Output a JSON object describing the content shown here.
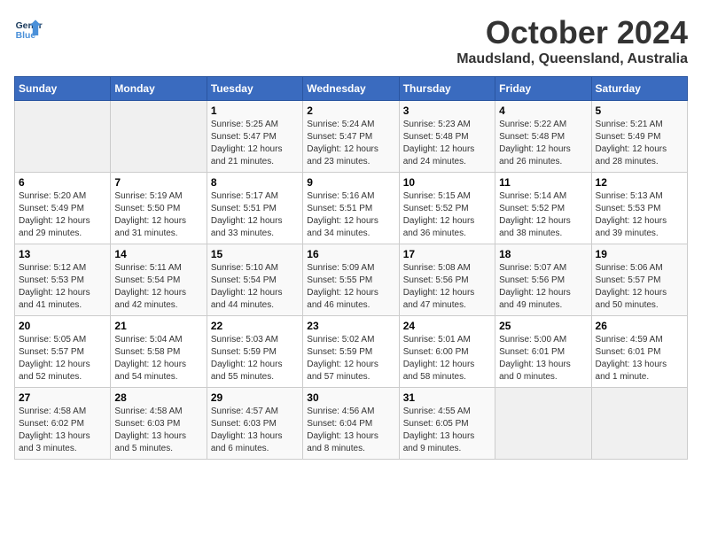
{
  "logo": {
    "line1": "General",
    "line2": "Blue"
  },
  "title": "October 2024",
  "location": "Maudsland, Queensland, Australia",
  "days_of_week": [
    "Sunday",
    "Monday",
    "Tuesday",
    "Wednesday",
    "Thursday",
    "Friday",
    "Saturday"
  ],
  "weeks": [
    [
      {
        "day": "",
        "sunrise": "",
        "sunset": "",
        "daylight": ""
      },
      {
        "day": "",
        "sunrise": "",
        "sunset": "",
        "daylight": ""
      },
      {
        "day": "1",
        "sunrise": "Sunrise: 5:25 AM",
        "sunset": "Sunset: 5:47 PM",
        "daylight": "Daylight: 12 hours and 21 minutes."
      },
      {
        "day": "2",
        "sunrise": "Sunrise: 5:24 AM",
        "sunset": "Sunset: 5:47 PM",
        "daylight": "Daylight: 12 hours and 23 minutes."
      },
      {
        "day": "3",
        "sunrise": "Sunrise: 5:23 AM",
        "sunset": "Sunset: 5:48 PM",
        "daylight": "Daylight: 12 hours and 24 minutes."
      },
      {
        "day": "4",
        "sunrise": "Sunrise: 5:22 AM",
        "sunset": "Sunset: 5:48 PM",
        "daylight": "Daylight: 12 hours and 26 minutes."
      },
      {
        "day": "5",
        "sunrise": "Sunrise: 5:21 AM",
        "sunset": "Sunset: 5:49 PM",
        "daylight": "Daylight: 12 hours and 28 minutes."
      }
    ],
    [
      {
        "day": "6",
        "sunrise": "Sunrise: 5:20 AM",
        "sunset": "Sunset: 5:49 PM",
        "daylight": "Daylight: 12 hours and 29 minutes."
      },
      {
        "day": "7",
        "sunrise": "Sunrise: 5:19 AM",
        "sunset": "Sunset: 5:50 PM",
        "daylight": "Daylight: 12 hours and 31 minutes."
      },
      {
        "day": "8",
        "sunrise": "Sunrise: 5:17 AM",
        "sunset": "Sunset: 5:51 PM",
        "daylight": "Daylight: 12 hours and 33 minutes."
      },
      {
        "day": "9",
        "sunrise": "Sunrise: 5:16 AM",
        "sunset": "Sunset: 5:51 PM",
        "daylight": "Daylight: 12 hours and 34 minutes."
      },
      {
        "day": "10",
        "sunrise": "Sunrise: 5:15 AM",
        "sunset": "Sunset: 5:52 PM",
        "daylight": "Daylight: 12 hours and 36 minutes."
      },
      {
        "day": "11",
        "sunrise": "Sunrise: 5:14 AM",
        "sunset": "Sunset: 5:52 PM",
        "daylight": "Daylight: 12 hours and 38 minutes."
      },
      {
        "day": "12",
        "sunrise": "Sunrise: 5:13 AM",
        "sunset": "Sunset: 5:53 PM",
        "daylight": "Daylight: 12 hours and 39 minutes."
      }
    ],
    [
      {
        "day": "13",
        "sunrise": "Sunrise: 5:12 AM",
        "sunset": "Sunset: 5:53 PM",
        "daylight": "Daylight: 12 hours and 41 minutes."
      },
      {
        "day": "14",
        "sunrise": "Sunrise: 5:11 AM",
        "sunset": "Sunset: 5:54 PM",
        "daylight": "Daylight: 12 hours and 42 minutes."
      },
      {
        "day": "15",
        "sunrise": "Sunrise: 5:10 AM",
        "sunset": "Sunset: 5:54 PM",
        "daylight": "Daylight: 12 hours and 44 minutes."
      },
      {
        "day": "16",
        "sunrise": "Sunrise: 5:09 AM",
        "sunset": "Sunset: 5:55 PM",
        "daylight": "Daylight: 12 hours and 46 minutes."
      },
      {
        "day": "17",
        "sunrise": "Sunrise: 5:08 AM",
        "sunset": "Sunset: 5:56 PM",
        "daylight": "Daylight: 12 hours and 47 minutes."
      },
      {
        "day": "18",
        "sunrise": "Sunrise: 5:07 AM",
        "sunset": "Sunset: 5:56 PM",
        "daylight": "Daylight: 12 hours and 49 minutes."
      },
      {
        "day": "19",
        "sunrise": "Sunrise: 5:06 AM",
        "sunset": "Sunset: 5:57 PM",
        "daylight": "Daylight: 12 hours and 50 minutes."
      }
    ],
    [
      {
        "day": "20",
        "sunrise": "Sunrise: 5:05 AM",
        "sunset": "Sunset: 5:57 PM",
        "daylight": "Daylight: 12 hours and 52 minutes."
      },
      {
        "day": "21",
        "sunrise": "Sunrise: 5:04 AM",
        "sunset": "Sunset: 5:58 PM",
        "daylight": "Daylight: 12 hours and 54 minutes."
      },
      {
        "day": "22",
        "sunrise": "Sunrise: 5:03 AM",
        "sunset": "Sunset: 5:59 PM",
        "daylight": "Daylight: 12 hours and 55 minutes."
      },
      {
        "day": "23",
        "sunrise": "Sunrise: 5:02 AM",
        "sunset": "Sunset: 5:59 PM",
        "daylight": "Daylight: 12 hours and 57 minutes."
      },
      {
        "day": "24",
        "sunrise": "Sunrise: 5:01 AM",
        "sunset": "Sunset: 6:00 PM",
        "daylight": "Daylight: 12 hours and 58 minutes."
      },
      {
        "day": "25",
        "sunrise": "Sunrise: 5:00 AM",
        "sunset": "Sunset: 6:01 PM",
        "daylight": "Daylight: 13 hours and 0 minutes."
      },
      {
        "day": "26",
        "sunrise": "Sunrise: 4:59 AM",
        "sunset": "Sunset: 6:01 PM",
        "daylight": "Daylight: 13 hours and 1 minute."
      }
    ],
    [
      {
        "day": "27",
        "sunrise": "Sunrise: 4:58 AM",
        "sunset": "Sunset: 6:02 PM",
        "daylight": "Daylight: 13 hours and 3 minutes."
      },
      {
        "day": "28",
        "sunrise": "Sunrise: 4:58 AM",
        "sunset": "Sunset: 6:03 PM",
        "daylight": "Daylight: 13 hours and 5 minutes."
      },
      {
        "day": "29",
        "sunrise": "Sunrise: 4:57 AM",
        "sunset": "Sunset: 6:03 PM",
        "daylight": "Daylight: 13 hours and 6 minutes."
      },
      {
        "day": "30",
        "sunrise": "Sunrise: 4:56 AM",
        "sunset": "Sunset: 6:04 PM",
        "daylight": "Daylight: 13 hours and 8 minutes."
      },
      {
        "day": "31",
        "sunrise": "Sunrise: 4:55 AM",
        "sunset": "Sunset: 6:05 PM",
        "daylight": "Daylight: 13 hours and 9 minutes."
      },
      {
        "day": "",
        "sunrise": "",
        "sunset": "",
        "daylight": ""
      },
      {
        "day": "",
        "sunrise": "",
        "sunset": "",
        "daylight": ""
      }
    ]
  ]
}
